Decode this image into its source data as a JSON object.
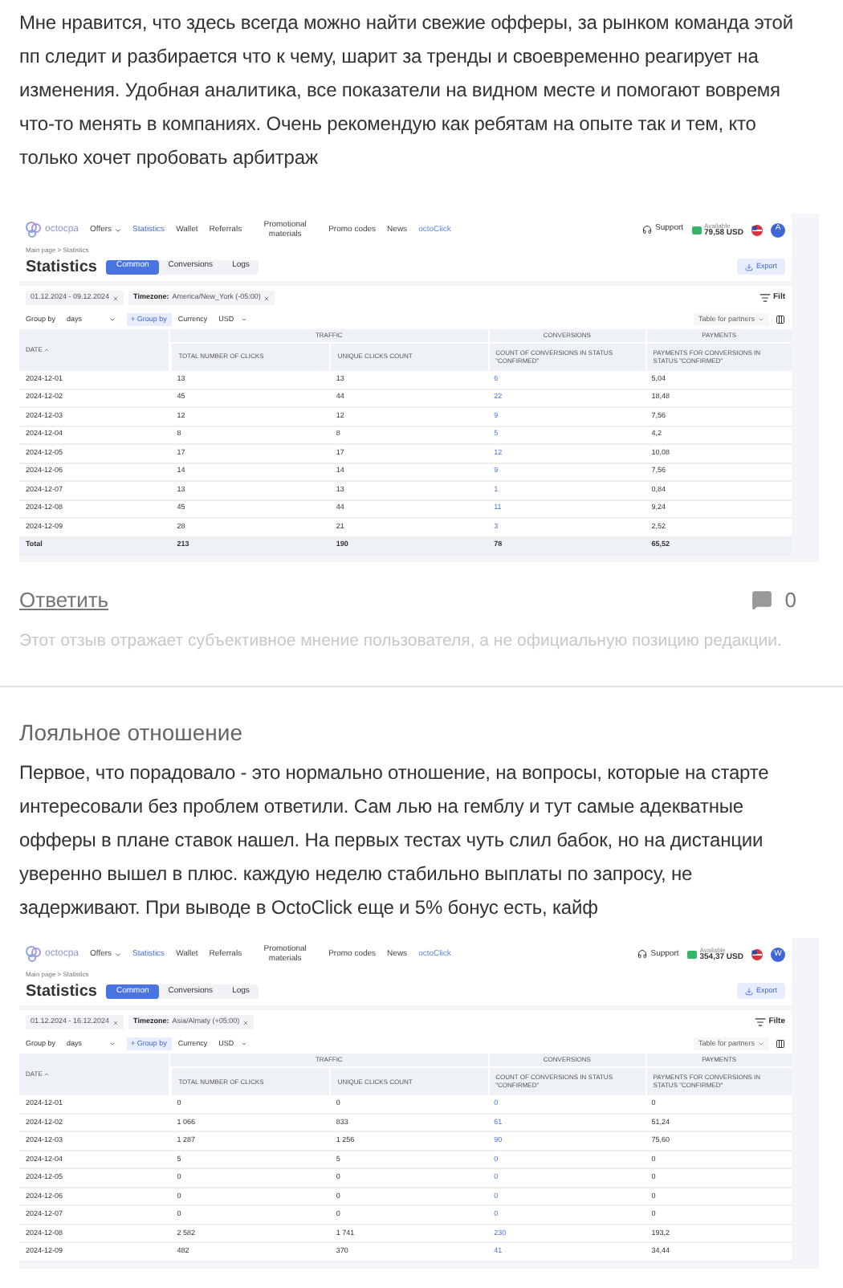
{
  "reviews": [
    {
      "text": "Мне нравится, что здесь всегда можно найти свежие офферы, за рынком команда этой пп следит и разбирается что к чему, шарит за тренды и своевременно  реагирует на изменения. Удобная аналитика, все показатели на видном месте и помогают вовремя что-то менять в компаниях. Очень рекомендую как ребятам на опыте так и тем, кто только хочет пробовать арбитраж",
      "screenshot": {
        "logo": "octocpa",
        "nav": [
          {
            "label": "Offers",
            "kind": "dropdown",
            "selected": false
          },
          {
            "label": "Statistics",
            "kind": "menu",
            "selected": true
          },
          {
            "label": "Wallet",
            "kind": "menu",
            "selected": false
          },
          {
            "label": "Referrals",
            "kind": "menu",
            "selected": false
          },
          {
            "label": "Promotional materials",
            "kind": "menu",
            "selected": false
          },
          {
            "label": "Promo codes",
            "kind": "menu",
            "selected": false
          },
          {
            "label": "News",
            "kind": "menu",
            "selected": false
          },
          {
            "label": "octoClick",
            "kind": "brand",
            "selected": false
          }
        ],
        "support": "Support",
        "balance_label": "Available",
        "balance": "79,58 USD",
        "avatar": "A",
        "breadcrumb": "Main page > Statistics",
        "title": "Statistics",
        "tabs": [
          {
            "label": "Common",
            "selected": true
          },
          {
            "label": "Conversions",
            "selected": false
          },
          {
            "label": "Logs",
            "selected": false
          }
        ],
        "export": "Export",
        "chips": [
          {
            "value": "01.12.2024 - 09.12.2024"
          },
          {
            "label": "Timezone:",
            "value": "America/New_York (-05:00)"
          }
        ],
        "filter": "Filt",
        "group_by_label": "Group by",
        "group_by_value": "days",
        "add_group": "+ Group by",
        "currency_label": "Currency",
        "currency_value": "USD",
        "table_preset": "Table for partners",
        "groups": [
          "TRAFFIC",
          "CONVERSIONS",
          "PAYMENTS"
        ],
        "columns": [
          "DATE",
          "TOTAL NUMBER OF CLICKS",
          "UNIQUE CLICKS COUNT",
          "COUNT OF CONVERSIONS IN STATUS \"CONFIRMED\"",
          "PAYMENTS FOR CONVERSIONS IN STATUS \"CONFIRMED\""
        ],
        "rows": [
          {
            "kind": "day",
            "cells": [
              "2024-12-01",
              "13",
              "13",
              "6",
              "5,04"
            ]
          },
          {
            "kind": "day",
            "cells": [
              "2024-12-02",
              "45",
              "44",
              "22",
              "18,48"
            ]
          },
          {
            "kind": "day",
            "cells": [
              "2024-12-03",
              "12",
              "12",
              "9",
              "7,56"
            ]
          },
          {
            "kind": "day",
            "cells": [
              "2024-12-04",
              "8",
              "8",
              "5",
              "4,2"
            ]
          },
          {
            "kind": "day",
            "cells": [
              "2024-12-05",
              "17",
              "17",
              "12",
              "10,08"
            ]
          },
          {
            "kind": "day",
            "cells": [
              "2024-12-06",
              "14",
              "14",
              "9",
              "7,56"
            ]
          },
          {
            "kind": "day",
            "cells": [
              "2024-12-07",
              "13",
              "13",
              "1",
              "0,84"
            ]
          },
          {
            "kind": "day",
            "cells": [
              "2024-12-08",
              "45",
              "44",
              "11",
              "9,24"
            ]
          },
          {
            "kind": "day",
            "cells": [
              "2024-12-09",
              "28",
              "21",
              "3",
              "2,52"
            ]
          },
          {
            "kind": "total",
            "cells": [
              "Total",
              "213",
              "190",
              "78",
              "65,52"
            ]
          }
        ]
      },
      "reply": "Ответить",
      "comment_count": "0",
      "disclaimer": "Этот отзыв отражает субъективное мнение пользователя, а не официальную позицию редакции."
    },
    {
      "title": "Лояльное отношение",
      "text": "Первое, что порадовало - это нормально отношение, на вопросы, которые на старте интересовали без проблем ответили. Сам лью на гемблу и тут самые адекватные офферы в плане ставок нашел. На первых тестах чуть слил бабок, но на дистанции уверенно вышел в плюс. каждую неделю стабильно выплаты по запросу, не задерживают. При выводе в OctoClick еще и 5% бонус есть, кайф",
      "screenshot": {
        "logo": "octocpa",
        "nav": [
          {
            "label": "Offers",
            "kind": "dropdown",
            "selected": false
          },
          {
            "label": "Statistics",
            "kind": "menu",
            "selected": true
          },
          {
            "label": "Wallet",
            "kind": "menu",
            "selected": false
          },
          {
            "label": "Referrals",
            "kind": "menu",
            "selected": false
          },
          {
            "label": "Promotional materials",
            "kind": "menu",
            "selected": false
          },
          {
            "label": "Promo codes",
            "kind": "menu",
            "selected": false
          },
          {
            "label": "News",
            "kind": "menu",
            "selected": false
          },
          {
            "label": "octoClick",
            "kind": "brand",
            "selected": false
          }
        ],
        "support": "Support",
        "balance_label": "Available",
        "balance": "354,37 USD",
        "avatar": "W",
        "breadcrumb": "Main page > Statistics",
        "title": "Statistics",
        "tabs": [
          {
            "label": "Common",
            "selected": true
          },
          {
            "label": "Conversions",
            "selected": false
          },
          {
            "label": "Logs",
            "selected": false
          }
        ],
        "export": "Export",
        "chips": [
          {
            "value": "01.12.2024 - 16.12.2024"
          },
          {
            "label": "Timezone:",
            "value": "Asia/Almaty (+05:00)"
          }
        ],
        "filter": "Filte",
        "group_by_label": "Group by",
        "group_by_value": "days",
        "add_group": "+ Group by",
        "currency_label": "Currency",
        "currency_value": "USD",
        "table_preset": "Table for partners",
        "groups": [
          "TRAFFIC",
          "CONVERSIONS",
          "PAYMENTS"
        ],
        "columns": [
          "DATE",
          "TOTAL NUMBER OF CLICKS",
          "UNIQUE CLICKS COUNT",
          "COUNT OF CONVERSIONS IN STATUS \"CONFIRMED\"",
          "PAYMENTS FOR CONVERSIONS IN STATUS \"CONFIRMED\""
        ],
        "rows": [
          {
            "kind": "day",
            "cells": [
              "2024-12-01",
              "0",
              "0",
              "0",
              "0"
            ]
          },
          {
            "kind": "day",
            "cells": [
              "2024-12-02",
              "1 066",
              "833",
              "61",
              "51,24"
            ]
          },
          {
            "kind": "day",
            "cells": [
              "2024-12-03",
              "1 287",
              "1 256",
              "90",
              "75,60"
            ]
          },
          {
            "kind": "day",
            "cells": [
              "2024-12-04",
              "5",
              "5",
              "0",
              "0"
            ]
          },
          {
            "kind": "day",
            "cells": [
              "2024-12-05",
              "0",
              "0",
              "0",
              "0"
            ]
          },
          {
            "kind": "day",
            "cells": [
              "2024-12-06",
              "0",
              "0",
              "0",
              "0"
            ]
          },
          {
            "kind": "day",
            "cells": [
              "2024-12-07",
              "0",
              "0",
              "0",
              "0"
            ]
          },
          {
            "kind": "day",
            "cells": [
              "2024-12-08",
              "2 582",
              "1 741",
              "230",
              "193,2"
            ]
          },
          {
            "kind": "day",
            "cells": [
              "2024-12-09",
              "482",
              "370",
              "41",
              "34,44"
            ]
          }
        ]
      }
    }
  ]
}
